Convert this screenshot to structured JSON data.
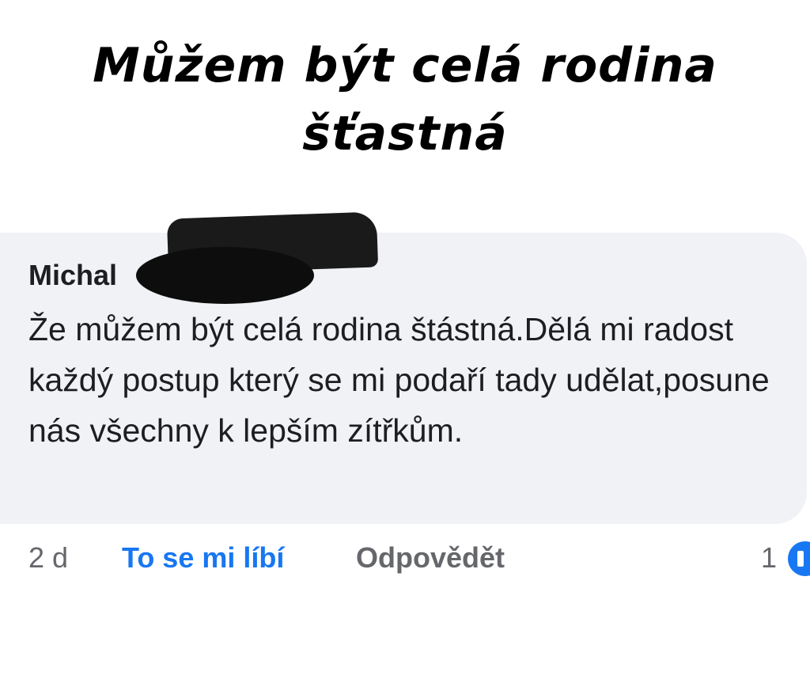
{
  "headline": {
    "line1": "Můžem být celá rodina",
    "line2": "šťastná"
  },
  "comment": {
    "author": "Michal",
    "text": "Že můžem být celá rodina štástná.Dělá mi radost každý postup který se mi podaří tady udělat,posune nás všechny k lepším zítřkům.",
    "time": "2 d",
    "like_label": "To se mi líbí",
    "reply_label": "Odpovědět",
    "reaction_count": "1",
    "reaction_icon": "like-thumb-icon"
  },
  "colors": {
    "bubble": "#f0f2f5",
    "link_blue": "#1877f2",
    "muted": "#65676b",
    "text": "#1c1e21"
  }
}
